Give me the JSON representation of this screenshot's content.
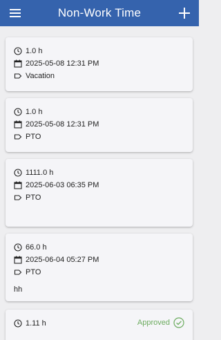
{
  "app_bar": {
    "title": "Non-Work Time",
    "menu_icon": "menu-icon",
    "add_icon": "add-icon",
    "color": "#3563ad"
  },
  "entries": [
    {
      "hours": "1.0 h",
      "datetime": "2025-05-08 12:31 PM",
      "type": "Vacation",
      "note": "",
      "status": ""
    },
    {
      "hours": "1.0 h",
      "datetime": "2025-05-08 12:31 PM",
      "type": "PTO",
      "note": "",
      "status": ""
    },
    {
      "hours": "1111.0 h",
      "datetime": "2025-06-03 06:35 PM",
      "type": "PTO",
      "note": "",
      "status": ""
    },
    {
      "hours": "66.0 h",
      "datetime": "2025-06-04 05:27 PM",
      "type": "PTO",
      "note": "hh",
      "status": ""
    },
    {
      "hours": "1.11 h",
      "datetime": "",
      "type": "",
      "note": "",
      "status": "Approved",
      "status_color": "#6bab5e"
    }
  ]
}
